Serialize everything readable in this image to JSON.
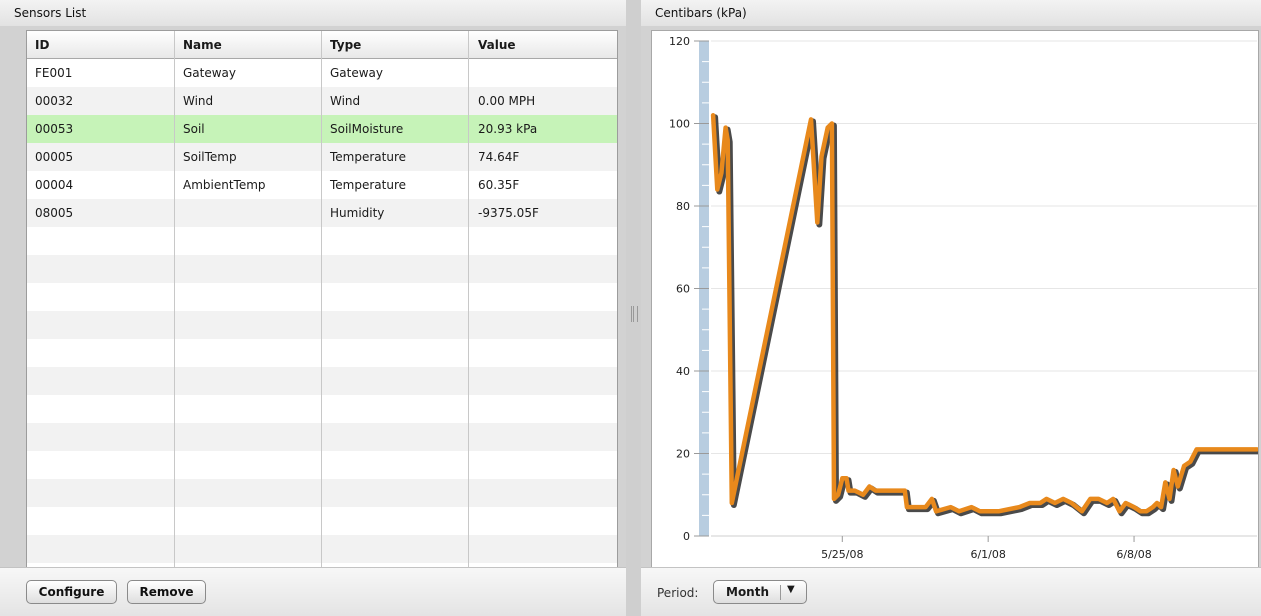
{
  "sensors_panel": {
    "title": "Sensors List",
    "columns": [
      "ID",
      "Name",
      "Type",
      "Value"
    ],
    "rows": [
      {
        "id": "FE001",
        "name": "Gateway",
        "type": "Gateway",
        "value": "",
        "selected": false
      },
      {
        "id": "00032",
        "name": "Wind",
        "type": "Wind",
        "value": "0.00 MPH",
        "selected": false
      },
      {
        "id": "00053",
        "name": "Soil",
        "type": "SoilMoisture",
        "value": "20.93 kPa",
        "selected": true
      },
      {
        "id": "00005",
        "name": "SoilTemp",
        "type": "Temperature",
        "value": "74.64F",
        "selected": false
      },
      {
        "id": "00004",
        "name": "AmbientTemp",
        "type": "Temperature",
        "value": "60.35F",
        "selected": false
      },
      {
        "id": "08005",
        "name": "",
        "type": "Humidity",
        "value": "-9375.05F",
        "selected": false
      }
    ],
    "buttons": {
      "configure": "Configure",
      "remove": "Remove"
    }
  },
  "chart_panel": {
    "title": "Centibars (kPa)",
    "period_label": "Period:",
    "period_value": "Month"
  },
  "colors": {
    "line": "#e8891c",
    "selected_row": "#c6f3b8",
    "axis_band": "#b8cde0"
  },
  "chart_data": {
    "type": "line",
    "title": "Centibars (kPa)",
    "xlabel": "",
    "ylabel": "",
    "ylim": [
      0,
      120
    ],
    "yticks": [
      0,
      20,
      40,
      60,
      80,
      100,
      120
    ],
    "xticks": [
      {
        "label": "5/25/08",
        "x": 25.0
      },
      {
        "label": "6/1/08",
        "x": 32.0
      },
      {
        "label": "6/8/08",
        "x": 39.0
      }
    ],
    "xlim": [
      18.7,
      44.9
    ],
    "grid": true,
    "series": [
      {
        "values": [
          [
            18.8,
            102
          ],
          [
            19.0,
            84
          ],
          [
            19.2,
            88
          ],
          [
            19.4,
            99
          ],
          [
            19.5,
            96
          ],
          [
            19.7,
            8
          ],
          [
            23.5,
            101
          ],
          [
            23.8,
            76
          ],
          [
            24.0,
            92
          ],
          [
            24.3,
            99
          ],
          [
            24.5,
            100
          ],
          [
            24.6,
            9
          ],
          [
            24.8,
            10
          ],
          [
            25.0,
            14
          ],
          [
            25.2,
            14
          ],
          [
            25.3,
            11
          ],
          [
            25.6,
            11
          ],
          [
            26.0,
            10
          ],
          [
            26.3,
            12
          ],
          [
            26.6,
            11
          ],
          [
            28.0,
            11
          ],
          [
            28.1,
            7
          ],
          [
            29.0,
            7
          ],
          [
            29.3,
            9
          ],
          [
            29.5,
            6
          ],
          [
            30.2,
            7
          ],
          [
            30.6,
            6
          ],
          [
            31.2,
            7
          ],
          [
            31.6,
            6
          ],
          [
            32.5,
            6
          ],
          [
            33.5,
            7
          ],
          [
            34.0,
            8
          ],
          [
            34.5,
            8
          ],
          [
            34.8,
            9
          ],
          [
            35.2,
            8
          ],
          [
            35.6,
            9
          ],
          [
            36.0,
            8
          ],
          [
            36.5,
            6
          ],
          [
            36.9,
            9
          ],
          [
            37.3,
            9
          ],
          [
            37.7,
            8
          ],
          [
            38.0,
            9
          ],
          [
            38.3,
            6
          ],
          [
            38.6,
            8
          ],
          [
            39.0,
            7
          ],
          [
            39.3,
            6
          ],
          [
            39.6,
            6
          ],
          [
            39.9,
            7
          ],
          [
            40.1,
            8
          ],
          [
            40.3,
            7
          ],
          [
            40.5,
            13
          ],
          [
            40.7,
            9
          ],
          [
            40.9,
            16
          ],
          [
            41.1,
            12
          ],
          [
            41.4,
            17
          ],
          [
            41.7,
            18
          ],
          [
            42.0,
            21
          ],
          [
            44.9,
            21
          ]
        ]
      }
    ]
  }
}
